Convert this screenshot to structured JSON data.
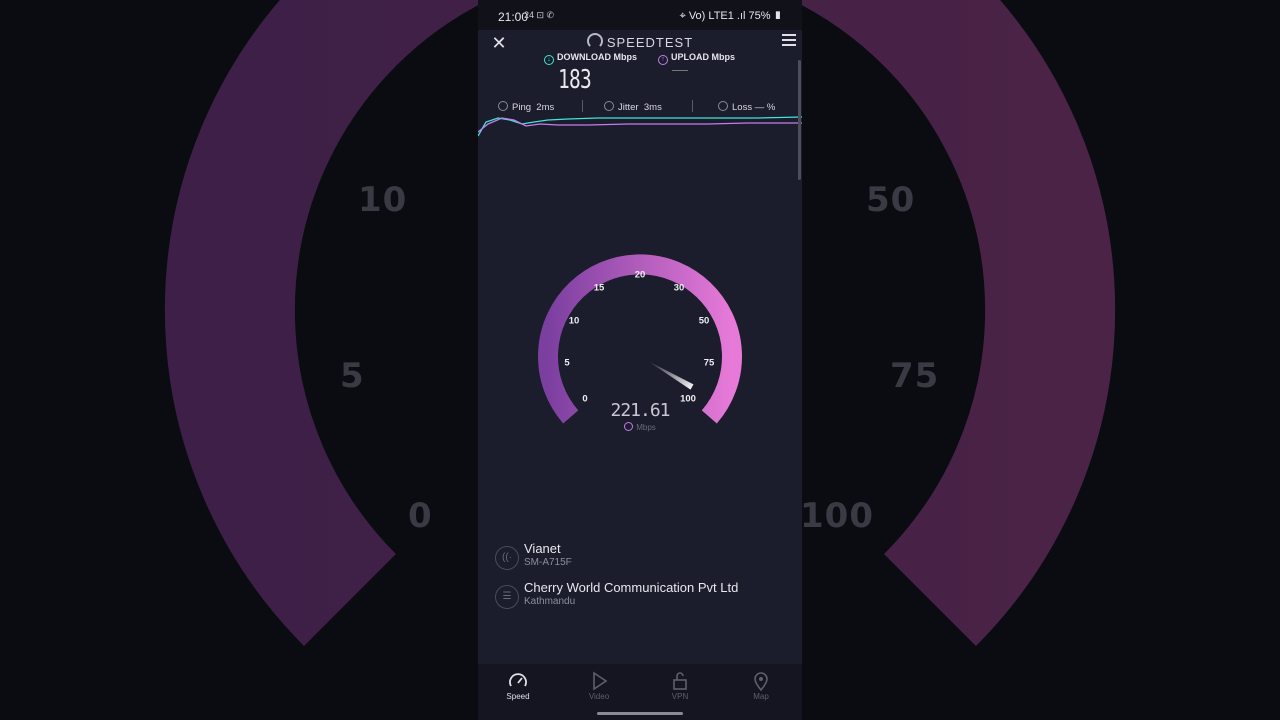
{
  "background": {
    "labels": [
      "10",
      "50",
      "5",
      "75",
      "0",
      "100"
    ]
  },
  "status_bar": {
    "time": "21:00",
    "left_icons": "24 ⊡ ✆",
    "right_text": "Vo) LTE1 .ıl 75%",
    "battery": "75%"
  },
  "header": {
    "brand": "SPEEDTEST"
  },
  "results": {
    "download_label": "DOWNLOAD Mbps",
    "download_value": "183",
    "upload_label": "UPLOAD Mbps",
    "upload_value": ""
  },
  "stats": {
    "ping_label": "Ping",
    "ping_value": "2ms",
    "jitter_label": "Jitter",
    "jitter_value": "3ms",
    "loss_label": "Loss",
    "loss_value": "— %"
  },
  "gauge": {
    "ticks": [
      "0",
      "5",
      "10",
      "15",
      "20",
      "30",
      "50",
      "75",
      "100"
    ],
    "value": "221.61",
    "unit": "Mbps",
    "needle_level": 1.0
  },
  "connection": {
    "provider": "Vianet",
    "device": "SM-A715F",
    "server": "Cherry World Communication Pvt Ltd",
    "location": "Kathmandu"
  },
  "nav": {
    "items": [
      {
        "label": "Speed",
        "icon": "speed-icon",
        "active": true
      },
      {
        "label": "Video",
        "icon": "play-icon",
        "active": false
      },
      {
        "label": "VPN",
        "icon": "lock-icon",
        "active": false
      },
      {
        "label": "Map",
        "icon": "map-pin-icon",
        "active": false
      }
    ]
  },
  "colors": {
    "download": "#3ee6d8",
    "upload": "#c27ee8",
    "gauge_start": "#7b3fa0",
    "gauge_end": "#e77ad8"
  }
}
